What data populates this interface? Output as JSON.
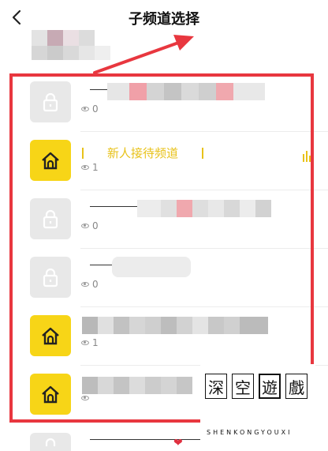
{
  "header": {
    "back_icon": "chevron-left-icon",
    "title": "子频道选择"
  },
  "colors": {
    "highlight_border": "#e8373f",
    "lock_tile": "#e8e8e8",
    "home_tile": "#f7d517",
    "active_text": "#e8c21a"
  },
  "channels": [
    {
      "icon": "lock-icon",
      "count": "0"
    },
    {
      "icon": "home-icon",
      "name": "新人接待频道",
      "count": "1",
      "active": true
    },
    {
      "icon": "lock-icon",
      "count": "0"
    },
    {
      "icon": "lock-icon",
      "count": "0"
    },
    {
      "icon": "home-icon",
      "count": "1"
    },
    {
      "icon": "home-icon",
      "count": ""
    },
    {
      "icon": "lock-icon",
      "count": ""
    }
  ],
  "watermark": {
    "chars": [
      "深",
      "空",
      "遊",
      "戲"
    ],
    "subtitle": "SHENKONGYOUXI"
  }
}
